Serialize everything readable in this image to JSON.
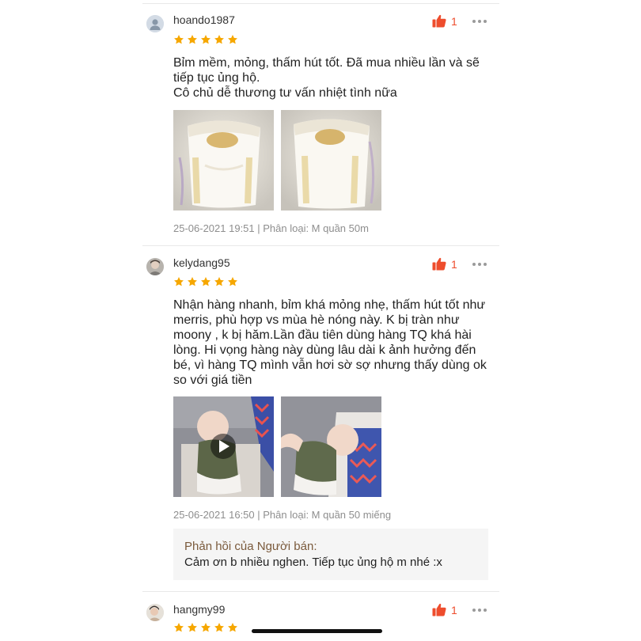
{
  "colors": {
    "accent": "#ee4d2d",
    "star": "#f6a700",
    "reply_title": "#7a5a3c"
  },
  "reviews": [
    {
      "username": "hoando1987",
      "avatar": "default-user-icon",
      "rating": 5,
      "likes": "1",
      "text_lines": [
        "Bỉm mềm, mỏng, thấm hút tốt. Đã mua nhiều lần và sẽ",
        "tiếp tục ủng hộ.",
        "Cô chủ dễ thương tư vấn nhiệt tình nữa"
      ],
      "media": [
        "diaper-photo",
        "diaper-photo"
      ],
      "meta": "25-06-2021 19:51 | Phân loại: M quần 50m"
    },
    {
      "username": "kelydang95",
      "avatar": "user-photo",
      "rating": 5,
      "likes": "1",
      "text_lines": [
        "Nhận hàng nhanh, bỉm khá mỏng nhẹ, thấm hút tốt như",
        "merris, phù hợp vs mùa hè nóng này. K bị tràn như",
        "moony , k bị hăm.Lần đầu tiên dùng hàng TQ khá hài",
        "lòng. Hi vọng hàng này dùng lâu dài k ảnh hưởng đến",
        "bé, vì hàng TQ mình vẫn hơi sờ sợ nhưng thấy dùng ok",
        "so với giá tiền"
      ],
      "media": [
        "baby-video",
        "baby-photo"
      ],
      "meta": "25-06-2021 16:50 | Phân loại: M quần 50 miếng",
      "reply": {
        "title": "Phản hồi của Người bán:",
        "body": "Cảm ơn b nhiều nghen. Tiếp tục ủng hộ m nhé :x"
      }
    },
    {
      "username": "hangmy99",
      "avatar": "user-photo",
      "rating": 5,
      "likes": "1"
    }
  ]
}
